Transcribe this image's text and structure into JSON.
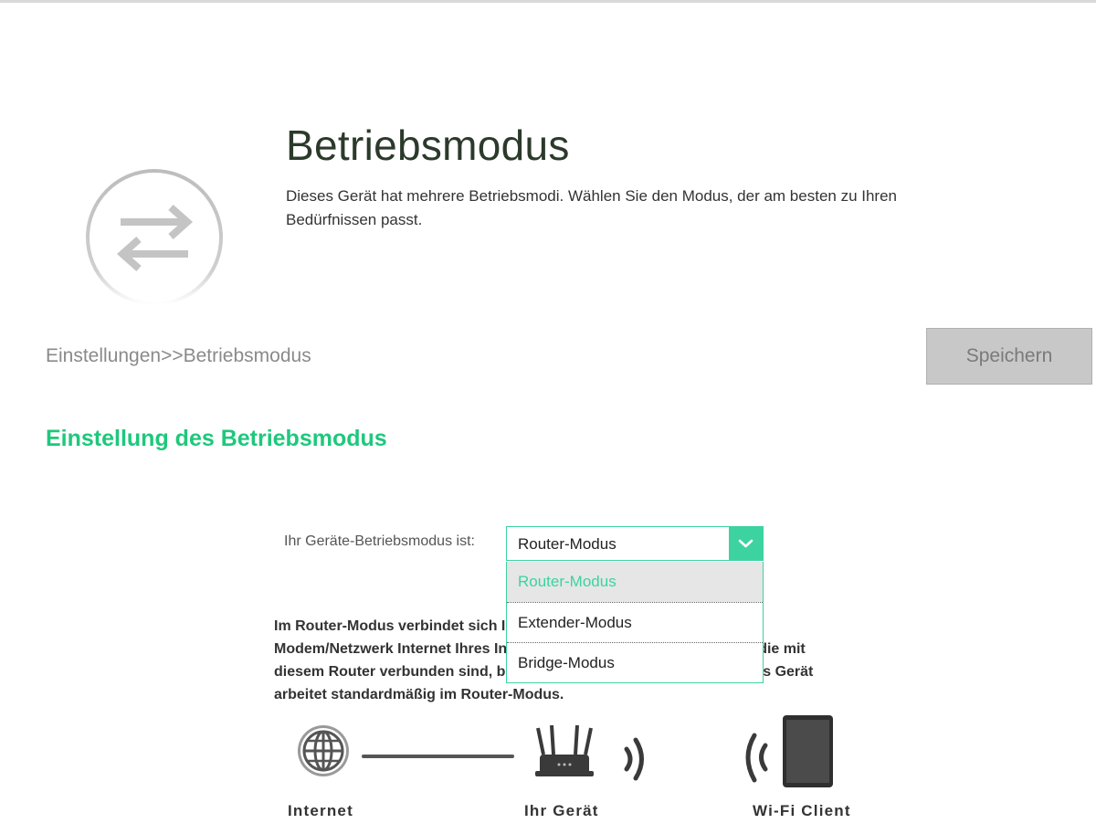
{
  "header": {
    "title": "Betriebsmodus",
    "description": "Dieses Gerät hat mehrere Betriebsmodi. Wählen Sie den Modus, der am besten zu Ihren Bedürfnissen passt."
  },
  "breadcrumb": "Einstellungen>>Betriebsmodus",
  "toolbar": {
    "save_label": "Speichern"
  },
  "section": {
    "title": "Einstellung des Betriebsmodus",
    "mode_label": "Ihr Geräte-Betriebsmodus ist:",
    "selected_mode": "Router-Modus",
    "options": [
      {
        "label": "Router-Modus",
        "selected": true
      },
      {
        "label": "Extender-Modus",
        "selected": false
      },
      {
        "label": "Bridge-Modus",
        "selected": false
      }
    ],
    "description": "Im Router-Modus verbindet sich Ihr Gerät mit dem Internet über das Modem/Netzwerk Internet Ihres Internet-Anbieters. Alle Client-Geräte, die mit diesem Router verbunden sind, befinden sich unter diesem Router. Das Gerät arbeitet standardmäßig im Router-Modus."
  },
  "diagram": {
    "internet_label": "Internet",
    "device_label": "Ihr Gerät",
    "client_label": "Wi-Fi Client",
    "icons": [
      "globe-icon",
      "router-icon",
      "wifi-signal-icon",
      "tablet-icon"
    ]
  },
  "colors": {
    "accent": "#3cd3a0",
    "section_title": "#1ec87c",
    "save_button_bg": "#c8c8c8"
  }
}
